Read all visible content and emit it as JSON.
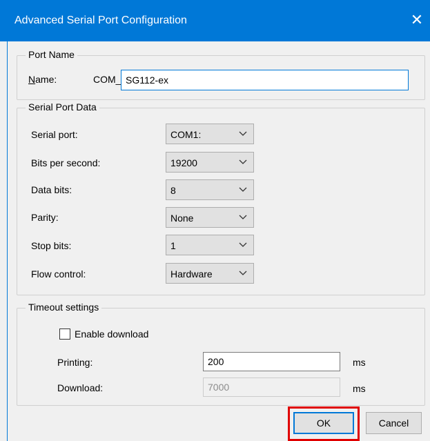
{
  "window": {
    "title": "Advanced Serial Port Configuration",
    "close_glyph": "✕"
  },
  "port_name": {
    "legend": "Port Name",
    "name_label_underlined": "N",
    "name_label_rest": "ame:",
    "prefix": "COM_",
    "value": "SG112-ex"
  },
  "serial": {
    "legend": "Serial Port Data",
    "fields": [
      {
        "label": "Serial port:",
        "value": "COM1:"
      },
      {
        "label": "Bits per second:",
        "value": "19200"
      },
      {
        "label": "Data bits:",
        "value": "8"
      },
      {
        "label": "Parity:",
        "value": "None"
      },
      {
        "label": "Stop bits:",
        "value": "1"
      },
      {
        "label": "Flow control:",
        "value": "Hardware"
      }
    ]
  },
  "timeout": {
    "legend": "Timeout settings",
    "enable_download_label": "Enable download",
    "enable_download_checked": false,
    "printing_label": "Printing:",
    "printing_value": "200",
    "printing_unit": "ms",
    "download_label": "Download:",
    "download_value": "7000",
    "download_unit": "ms"
  },
  "buttons": {
    "ok": "OK",
    "cancel": "Cancel"
  },
  "colors": {
    "titlebar": "#0078d7",
    "highlight": "#e00000",
    "focus": "#0078d7"
  }
}
